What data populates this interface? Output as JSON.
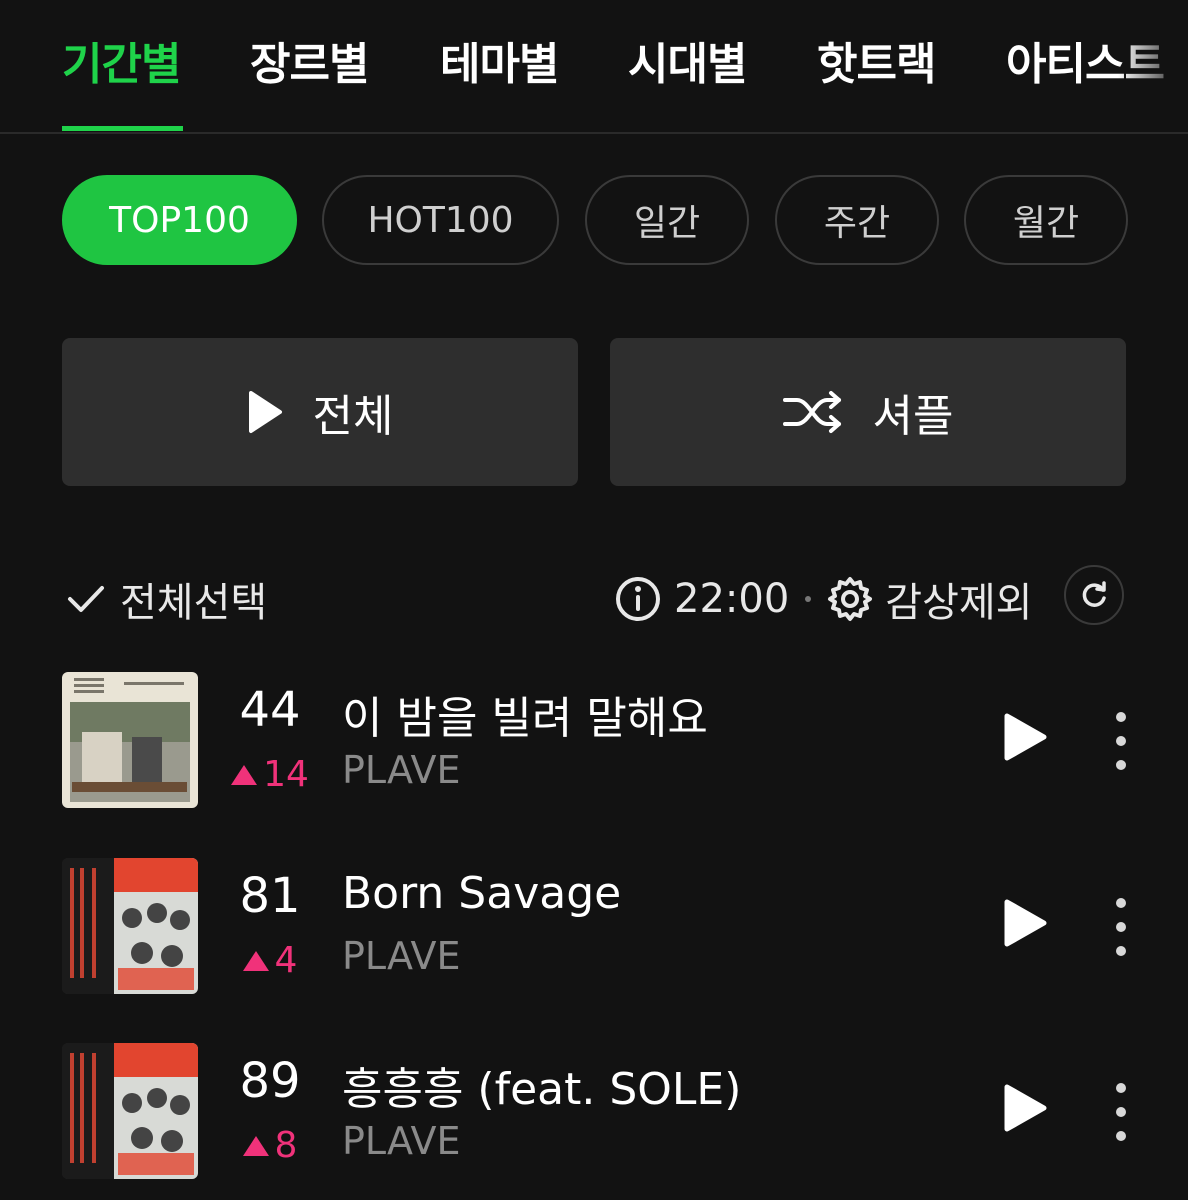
{
  "top_tabs": [
    "기간별",
    "장르별",
    "테마별",
    "시대별",
    "핫트랙",
    "아티스트"
  ],
  "chips": [
    "TOP100",
    "HOT100",
    "일간",
    "주간",
    "월간"
  ],
  "actions": {
    "play_all": "전체",
    "shuffle": "셔플"
  },
  "select_all": "전체선택",
  "update_time": "22:00",
  "exclude_label": "감상제외",
  "songs": [
    {
      "rank": "44",
      "change": "14",
      "title": "이 밤을 빌려 말해요",
      "artist": "PLAVE"
    },
    {
      "rank": "81",
      "change": "4",
      "title": "Born Savage",
      "artist": "PLAVE"
    },
    {
      "rank": "89",
      "change": "8",
      "title": "흥흥흥 (feat. SOLE)",
      "artist": "PLAVE"
    }
  ],
  "colors": {
    "accent": "#1fd34a",
    "rank_up": "#f0327a",
    "background": "#121212"
  }
}
